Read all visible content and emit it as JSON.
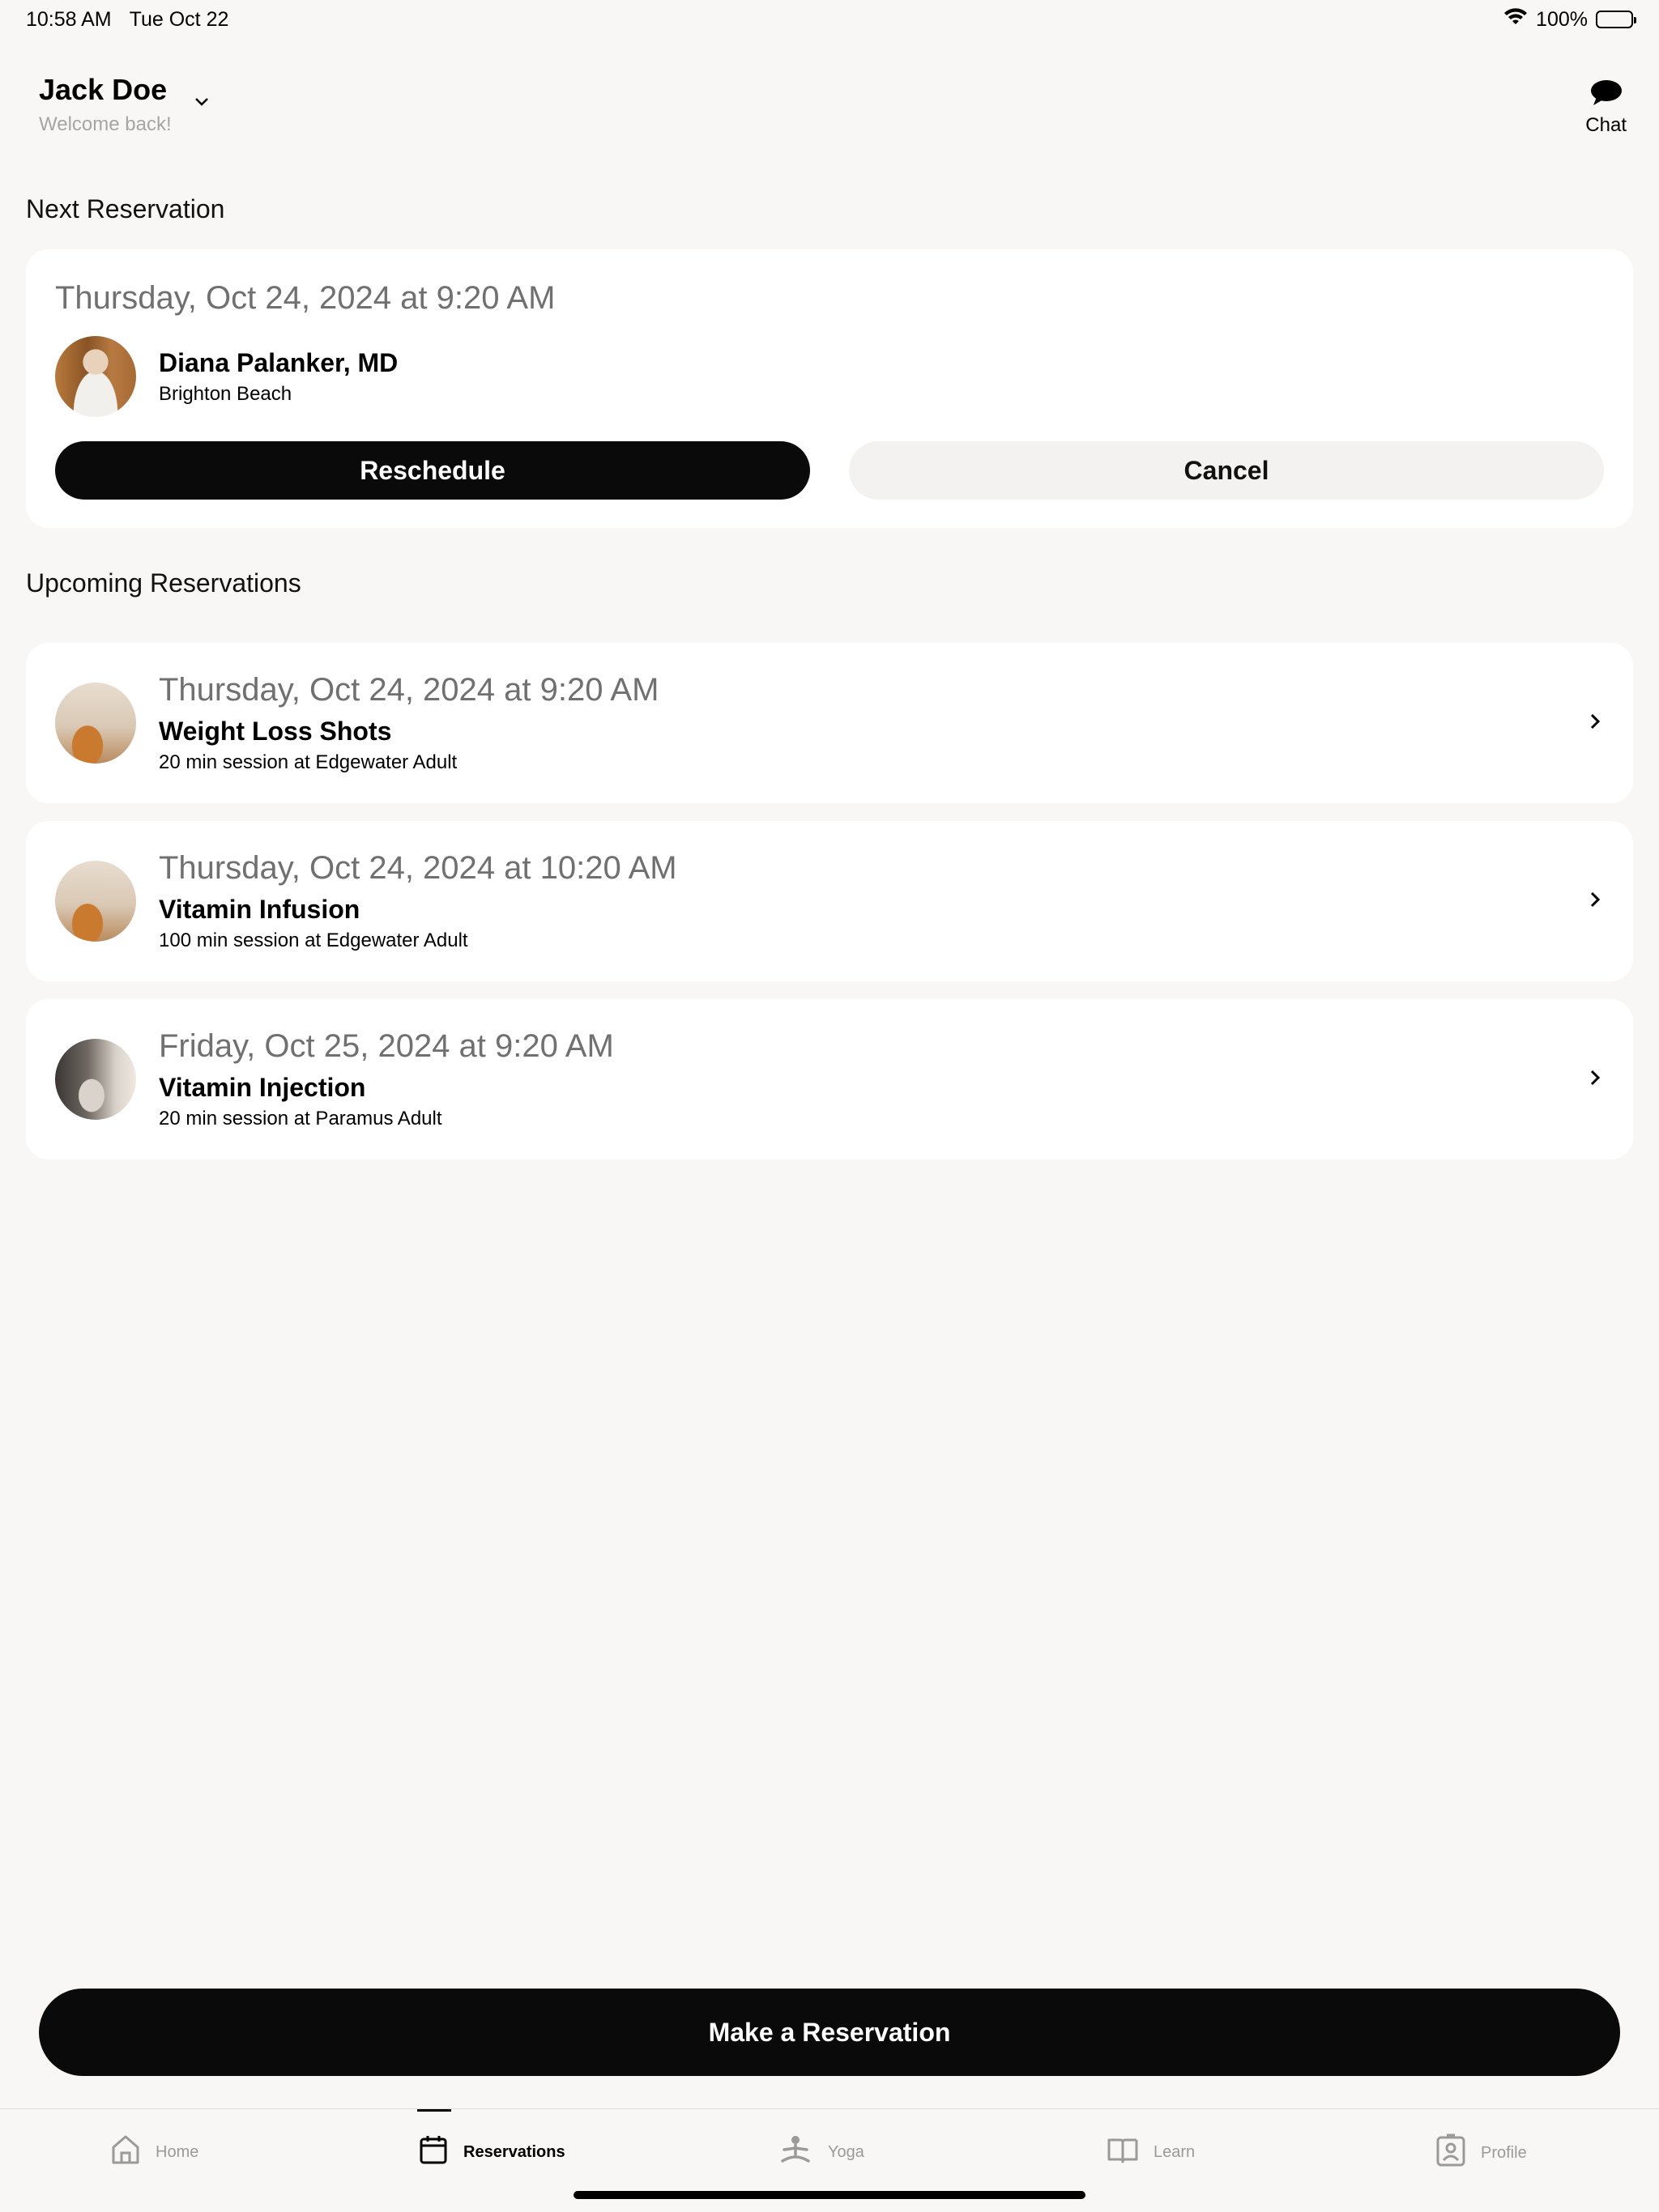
{
  "status_bar": {
    "time": "10:58 AM",
    "date": "Tue Oct 22",
    "battery": "100%"
  },
  "header": {
    "user_name": "Jack Doe",
    "welcome": "Welcome back!",
    "chat_label": "Chat"
  },
  "next_reservation": {
    "section_title": "Next Reservation",
    "datetime": "Thursday, Oct 24, 2024 at 9:20 AM",
    "provider_name": "Diana Palanker, MD",
    "location": "Brighton Beach",
    "reschedule_label": "Reschedule",
    "cancel_label": "Cancel"
  },
  "upcoming": {
    "section_title": "Upcoming Reservations",
    "items": [
      {
        "datetime": "Thursday, Oct 24, 2024 at 9:20 AM",
        "title": "Weight Loss Shots",
        "subtitle": "20 min session at Edgewater Adult"
      },
      {
        "datetime": "Thursday, Oct 24, 2024 at 10:20 AM",
        "title": "Vitamin Infusion",
        "subtitle": "100 min session at Edgewater Adult"
      },
      {
        "datetime": "Friday, Oct 25, 2024 at 9:20 AM",
        "title": "Vitamin Injection",
        "subtitle": "20 min session at Paramus Adult"
      }
    ]
  },
  "make_reservation_label": "Make a Reservation",
  "tabs": [
    {
      "label": "Home",
      "icon": "home-icon",
      "active": false
    },
    {
      "label": "Reservations",
      "icon": "calendar-icon",
      "active": true
    },
    {
      "label": "Yoga",
      "icon": "yoga-icon",
      "active": false
    },
    {
      "label": "Learn",
      "icon": "book-icon",
      "active": false
    },
    {
      "label": "Profile",
      "icon": "profile-icon",
      "active": false
    }
  ]
}
